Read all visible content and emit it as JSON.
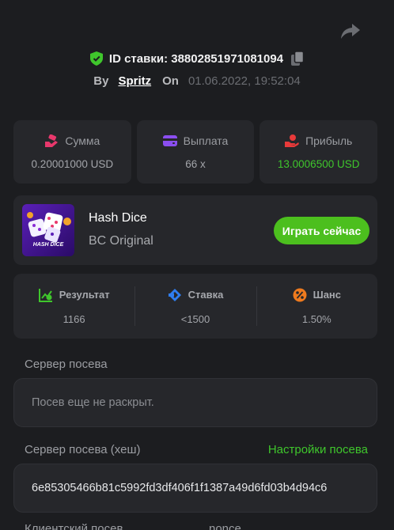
{
  "bet": {
    "id_label": "ID ставки: 38802851971081094",
    "by": "By",
    "user": "Spritz",
    "on": "On",
    "date": "01.06.2022, 19:52:04"
  },
  "stats": [
    {
      "label": "Сумма",
      "value": "0.20001000 USD",
      "icon": "coins-icon"
    },
    {
      "label": "Выплата",
      "value": "66 x",
      "icon": "wallet-icon"
    },
    {
      "label": "Прибыль",
      "value": "13.0006500 USD",
      "icon": "profit-hand-icon"
    }
  ],
  "game": {
    "name": "Hash Dice",
    "provider": "BC Original",
    "thumb_text": "HASH DICE",
    "play_label": "Играть сейчас"
  },
  "result": [
    {
      "label": "Результат",
      "value": "1166",
      "icon": "result-chart-icon"
    },
    {
      "label": "Ставка",
      "value": "<1500",
      "icon": "bet-tag-icon"
    },
    {
      "label": "Шанс",
      "value": "1.50%",
      "icon": "percent-icon"
    }
  ],
  "seed": {
    "server_label": "Сервер посева",
    "server_value": "Посев еще не раскрыт.",
    "hash_label": "Сервер посева (хеш)",
    "settings_link": "Настройки посева",
    "hash_value": "6e85305466b81c5992fd3df406f1f1387a49d6fd03b4d94c6",
    "client_label": "Клиентский посев",
    "nonce_label": "nonce"
  },
  "colors": {
    "accent_green": "#3fc62c",
    "button_green": "#4cbf1e",
    "card_bg": "#26272b",
    "page_bg": "#1c1d20"
  }
}
